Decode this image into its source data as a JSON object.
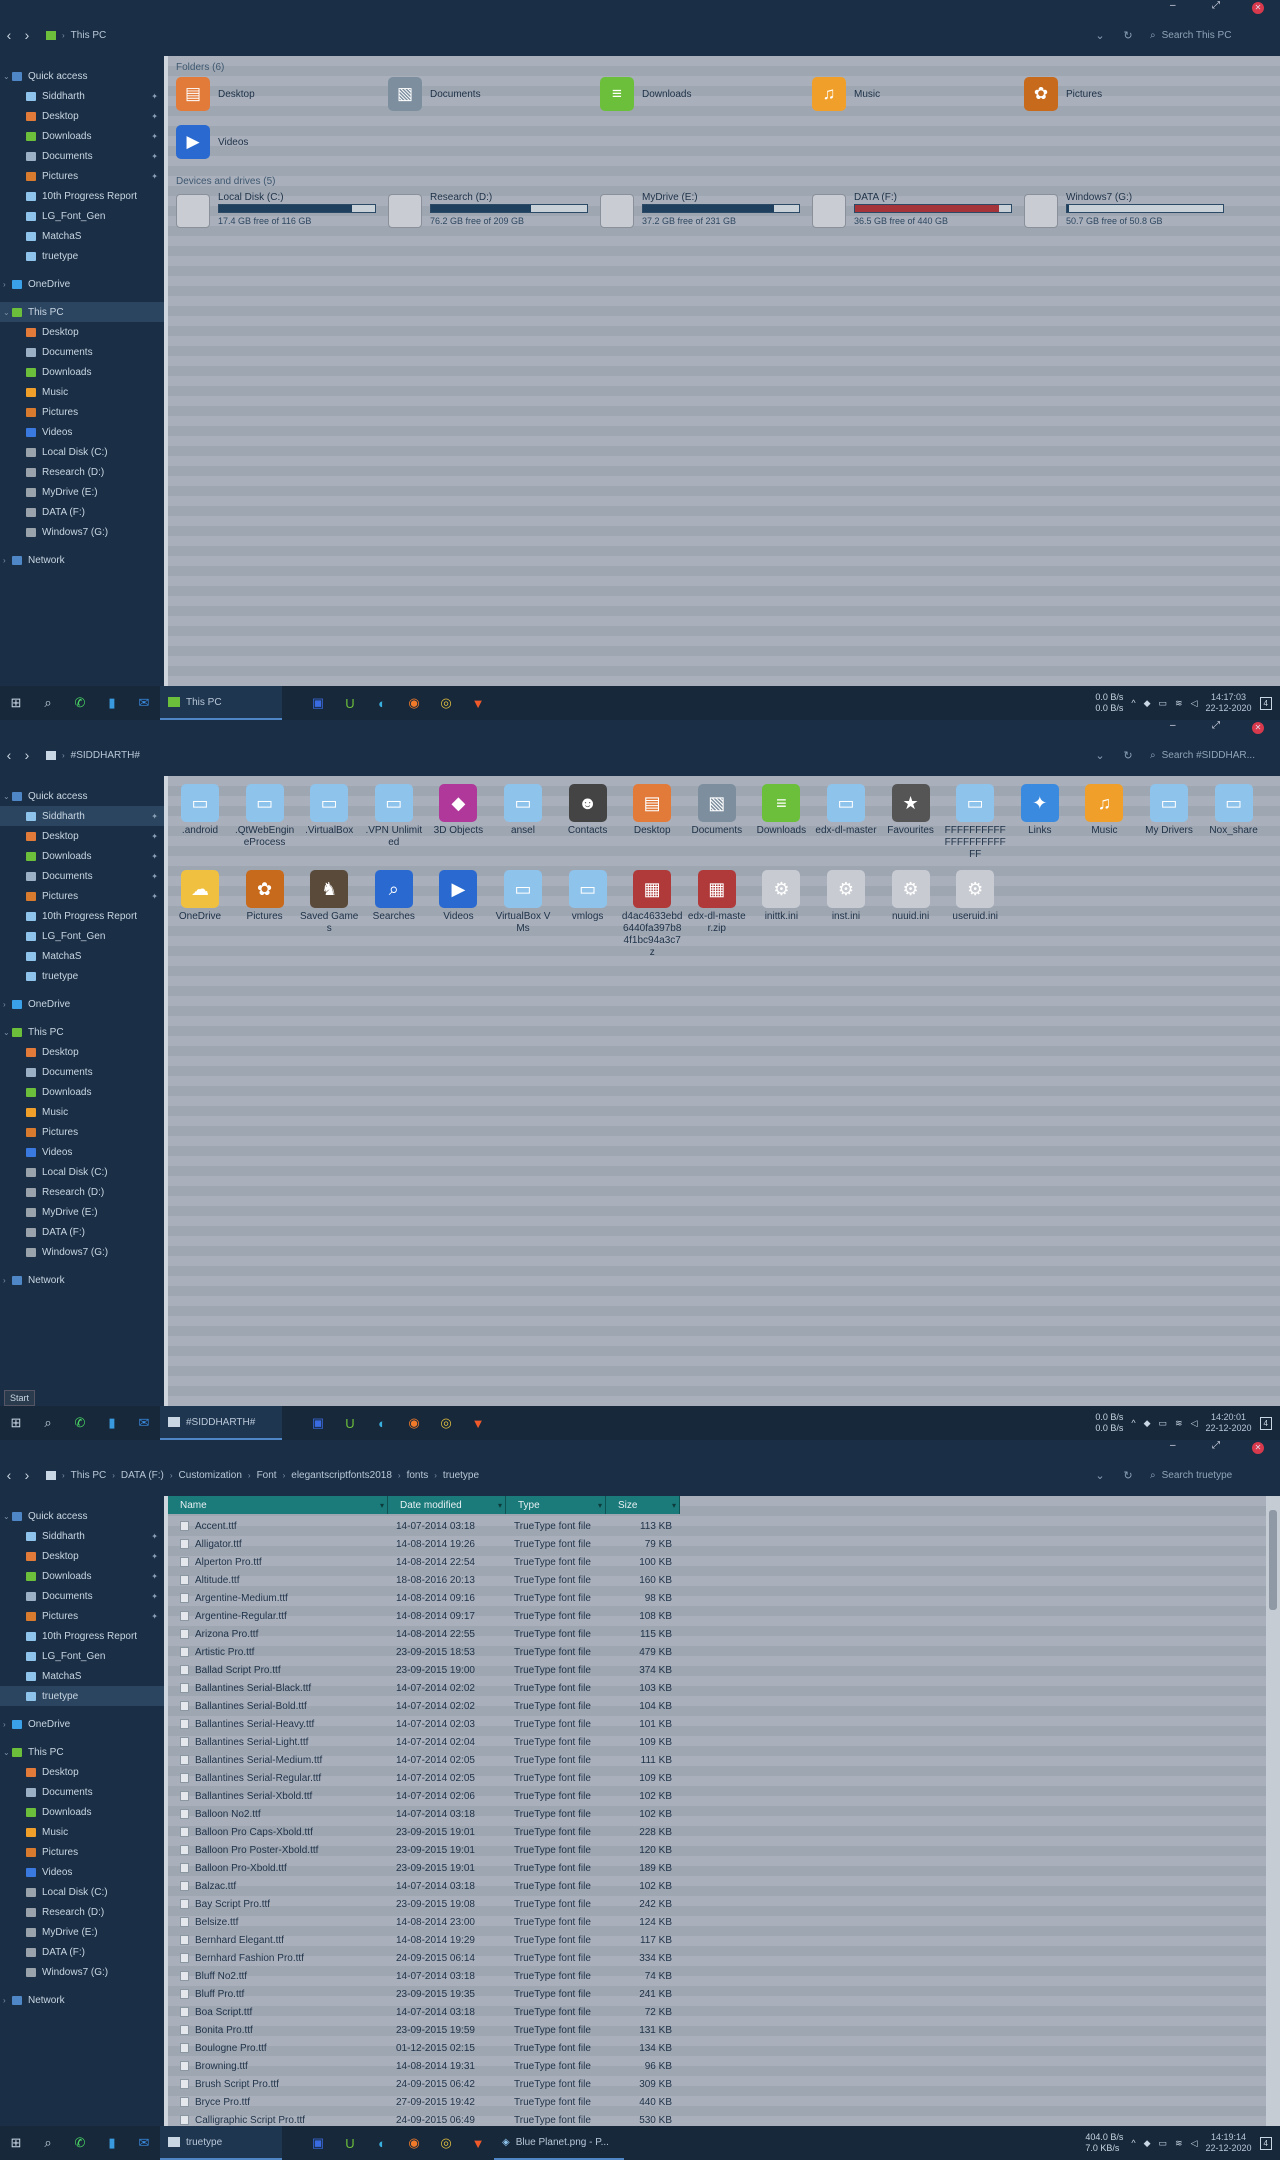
{
  "window_controls": {
    "minimize": "–",
    "maximize": "⤢",
    "close": "✕"
  },
  "nav": {
    "back": "‹",
    "forward": "›",
    "up": "↑",
    "refresh": "↻",
    "dropdown": "⌄"
  },
  "panel1": {
    "breadcrumbs": [
      "This PC"
    ],
    "search_placeholder": "Search This PC",
    "sidebar": [
      {
        "label": "Quick access",
        "kind": "top",
        "color": "#4f86c6",
        "icon": "star-icon"
      },
      {
        "label": "Siddharth",
        "kind": "sub",
        "pin": true,
        "color": "#8ec3ec"
      },
      {
        "label": "Desktop",
        "kind": "sub",
        "pin": true,
        "color": "#e27a3a"
      },
      {
        "label": "Downloads",
        "kind": "sub",
        "pin": true,
        "color": "#6cbf3a"
      },
      {
        "label": "Documents",
        "kind": "sub",
        "pin": true,
        "color": "#9bb0c4"
      },
      {
        "label": "Pictures",
        "kind": "sub",
        "pin": true,
        "color": "#d97b2e"
      },
      {
        "label": "10th Progress Report",
        "kind": "sub",
        "color": "#8ec3ec"
      },
      {
        "label": "LG_Font_Gen",
        "kind": "sub",
        "color": "#8ec3ec"
      },
      {
        "label": "MatchaS",
        "kind": "sub",
        "color": "#8ec3ec"
      },
      {
        "label": "truetype",
        "kind": "sub",
        "color": "#8ec3ec"
      },
      {
        "label": "",
        "kind": "gap"
      },
      {
        "label": "OneDrive",
        "kind": "top",
        "color": "#3aa0e8",
        "icon": "cloud-icon"
      },
      {
        "label": "",
        "kind": "gap"
      },
      {
        "label": "This PC",
        "kind": "top",
        "sel": true,
        "color": "#6cbf3a",
        "icon": "computer-icon"
      },
      {
        "label": "Desktop",
        "kind": "sub",
        "color": "#e27a3a"
      },
      {
        "label": "Documents",
        "kind": "sub",
        "color": "#9bb0c4"
      },
      {
        "label": "Downloads",
        "kind": "sub",
        "color": "#6cbf3a"
      },
      {
        "label": "Music",
        "kind": "sub",
        "color": "#f0a02a"
      },
      {
        "label": "Pictures",
        "kind": "sub",
        "color": "#d97b2e"
      },
      {
        "label": "Videos",
        "kind": "sub",
        "color": "#3a7ae0"
      },
      {
        "label": "Local Disk (C:)",
        "kind": "sub",
        "color": "#9aa2ab"
      },
      {
        "label": "Research (D:)",
        "kind": "sub",
        "color": "#9aa2ab"
      },
      {
        "label": "MyDrive (E:)",
        "kind": "sub",
        "color": "#9aa2ab"
      },
      {
        "label": "DATA (F:)",
        "kind": "sub",
        "color": "#9aa2ab"
      },
      {
        "label": "Windows7 (G:)",
        "kind": "sub",
        "color": "#9aa2ab"
      },
      {
        "label": "",
        "kind": "gap"
      },
      {
        "label": "Network",
        "kind": "top",
        "color": "#4f86c6",
        "icon": "network-icon"
      }
    ],
    "folders_header": "Folders (6)",
    "folders": [
      {
        "label": "Desktop",
        "color": "#e27a3a",
        "glyph": "▤"
      },
      {
        "label": "Documents",
        "color": "#7d8f9f",
        "glyph": "▧"
      },
      {
        "label": "Downloads",
        "color": "#6cbf3a",
        "glyph": "≡"
      },
      {
        "label": "Music",
        "color": "#f0a02a",
        "glyph": "♫"
      },
      {
        "label": "Pictures",
        "color": "#c86a1c",
        "glyph": "✿"
      },
      {
        "label": "Videos",
        "color": "#2a6ad0",
        "glyph": "▶"
      }
    ],
    "drives_header": "Devices and drives (5)",
    "drives": [
      {
        "name": "Local Disk (C:)",
        "free": "17.4 GB free of 116 GB",
        "used": 0.85,
        "color": "#1f3f5f"
      },
      {
        "name": "Research (D:)",
        "free": "76.2 GB free of 209 GB",
        "used": 0.64,
        "color": "#1f3f5f"
      },
      {
        "name": "MyDrive (E:)",
        "free": "37.2 GB free of 231 GB",
        "used": 0.84,
        "color": "#1f3f5f"
      },
      {
        "name": "DATA (F:)",
        "free": "36.5 GB free of 440 GB",
        "used": 0.92,
        "color": "#a4333a"
      },
      {
        "name": "Windows7 (G:)",
        "free": "50.7 GB free of 50.8 GB",
        "used": 0.01,
        "color": "#1f3f5f"
      }
    ],
    "taskbar_app": "This PC",
    "speed_up": "0.0 B/s",
    "speed_down": "0.0 B/s",
    "time": "14:17:03",
    "date": "22-12-2020",
    "notif": "4"
  },
  "panel2": {
    "breadcrumbs": [
      "#SIDDHARTH#"
    ],
    "search_placeholder": "Search #SIDDHAR...",
    "sidebar_selected": "Siddharth",
    "items": [
      {
        "label": ".android",
        "color": "#8ec3ec",
        "glyph": "▭"
      },
      {
        "label": ".QtWebEngineProcess",
        "color": "#8ec3ec",
        "glyph": "▭"
      },
      {
        "label": ".VirtualBox",
        "color": "#8ec3ec",
        "glyph": "▭"
      },
      {
        "label": ".VPN Unlimited",
        "color": "#8ec3ec",
        "glyph": "▭"
      },
      {
        "label": "3D Objects",
        "color": "#b0389a",
        "glyph": "◆"
      },
      {
        "label": "ansel",
        "color": "#8ec3ec",
        "glyph": "▭"
      },
      {
        "label": "Contacts",
        "color": "#444444",
        "glyph": "☻"
      },
      {
        "label": "Desktop",
        "color": "#e27a3a",
        "glyph": "▤"
      },
      {
        "label": "Documents",
        "color": "#7d8f9f",
        "glyph": "▧"
      },
      {
        "label": "Downloads",
        "color": "#6cbf3a",
        "glyph": "≡"
      },
      {
        "label": "edx-dl-master",
        "color": "#8ec3ec",
        "glyph": "▭"
      },
      {
        "label": "Favourites",
        "color": "#555555",
        "glyph": "★"
      },
      {
        "label": "FFFFFFFFFFFFFFFFFFFFFF",
        "color": "#8ec3ec",
        "glyph": "▭"
      },
      {
        "label": "Links",
        "color": "#3a8ae0",
        "glyph": "✦"
      },
      {
        "label": "Music",
        "color": "#f0a02a",
        "glyph": "♫"
      },
      {
        "label": "My Drivers",
        "color": "#8ec3ec",
        "glyph": "▭"
      },
      {
        "label": "Nox_share",
        "color": "#8ec3ec",
        "glyph": "▭"
      },
      {
        "label": "OneDrive",
        "color": "#f0c040",
        "glyph": "☁"
      },
      {
        "label": "Pictures",
        "color": "#c86a1c",
        "glyph": "✿"
      },
      {
        "label": "Saved Games",
        "color": "#5a4a3a",
        "glyph": "♞"
      },
      {
        "label": "Searches",
        "color": "#2a6ad0",
        "glyph": "⌕"
      },
      {
        "label": "Videos",
        "color": "#2a6ad0",
        "glyph": "▶"
      },
      {
        "label": "VirtualBox VMs",
        "color": "#8ec3ec",
        "glyph": "▭"
      },
      {
        "label": "vmlogs",
        "color": "#8ec3ec",
        "glyph": "▭"
      },
      {
        "label": "d4ac4633ebd6440fa397b84f1bc94a3c7z",
        "color": "#b03a3a",
        "glyph": "▦"
      },
      {
        "label": "edx-dl-master.zip",
        "color": "#b03a3a",
        "glyph": "▦"
      },
      {
        "label": "inittk.ini",
        "color": "#c8ccd2",
        "glyph": "⚙"
      },
      {
        "label": "inst.ini",
        "color": "#c8ccd2",
        "glyph": "⚙"
      },
      {
        "label": "nuuid.ini",
        "color": "#c8ccd2",
        "glyph": "⚙"
      },
      {
        "label": "useruid.ini",
        "color": "#c8ccd2",
        "glyph": "⚙"
      }
    ],
    "tooltip": "Start",
    "taskbar_app": "#SIDDHARTH#",
    "speed_up": "0.0 B/s",
    "speed_down": "0.0 B/s",
    "time": "14:20:01",
    "date": "22-12-2020",
    "notif": "4"
  },
  "panel3": {
    "breadcrumbs": [
      "This PC",
      "DATA (F:)",
      "Customization",
      "Font",
      "elegantscriptfonts2018",
      "fonts",
      "truetype"
    ],
    "search_placeholder": "Search truetype",
    "sidebar_selected": "truetype",
    "columns": [
      "Name",
      "Date modified",
      "Type",
      "Size"
    ],
    "rows": [
      [
        "Accent.ttf",
        "14-07-2014 03:18",
        "TrueType font file",
        "113 KB"
      ],
      [
        "Alligator.ttf",
        "14-08-2014 19:26",
        "TrueType font file",
        "79 KB"
      ],
      [
        "Alperton Pro.ttf",
        "14-08-2014 22:54",
        "TrueType font file",
        "100 KB"
      ],
      [
        "Altitude.ttf",
        "18-08-2016 20:13",
        "TrueType font file",
        "160 KB"
      ],
      [
        "Argentine-Medium.ttf",
        "14-08-2014 09:16",
        "TrueType font file",
        "98 KB"
      ],
      [
        "Argentine-Regular.ttf",
        "14-08-2014 09:17",
        "TrueType font file",
        "108 KB"
      ],
      [
        "Arizona Pro.ttf",
        "14-08-2014 22:55",
        "TrueType font file",
        "115 KB"
      ],
      [
        "Artistic Pro.ttf",
        "23-09-2015 18:53",
        "TrueType font file",
        "479 KB"
      ],
      [
        "Ballad Script Pro.ttf",
        "23-09-2015 19:00",
        "TrueType font file",
        "374 KB"
      ],
      [
        "Ballantines Serial-Black.ttf",
        "14-07-2014 02:02",
        "TrueType font file",
        "103 KB"
      ],
      [
        "Ballantines Serial-Bold.ttf",
        "14-07-2014 02:02",
        "TrueType font file",
        "104 KB"
      ],
      [
        "Ballantines Serial-Heavy.ttf",
        "14-07-2014 02:03",
        "TrueType font file",
        "101 KB"
      ],
      [
        "Ballantines Serial-Light.ttf",
        "14-07-2014 02:04",
        "TrueType font file",
        "109 KB"
      ],
      [
        "Ballantines Serial-Medium.ttf",
        "14-07-2014 02:05",
        "TrueType font file",
        "111 KB"
      ],
      [
        "Ballantines Serial-Regular.ttf",
        "14-07-2014 02:05",
        "TrueType font file",
        "109 KB"
      ],
      [
        "Ballantines Serial-Xbold.ttf",
        "14-07-2014 02:06",
        "TrueType font file",
        "102 KB"
      ],
      [
        "Balloon No2.ttf",
        "14-07-2014 03:18",
        "TrueType font file",
        "102 KB"
      ],
      [
        "Balloon Pro Caps-Xbold.ttf",
        "23-09-2015 19:01",
        "TrueType font file",
        "228 KB"
      ],
      [
        "Balloon Pro Poster-Xbold.ttf",
        "23-09-2015 19:01",
        "TrueType font file",
        "120 KB"
      ],
      [
        "Balloon Pro-Xbold.ttf",
        "23-09-2015 19:01",
        "TrueType font file",
        "189 KB"
      ],
      [
        "Balzac.ttf",
        "14-07-2014 03:18",
        "TrueType font file",
        "102 KB"
      ],
      [
        "Bay Script Pro.ttf",
        "23-09-2015 19:08",
        "TrueType font file",
        "242 KB"
      ],
      [
        "Belsize.ttf",
        "14-08-2014 23:00",
        "TrueType font file",
        "124 KB"
      ],
      [
        "Bernhard Elegant.ttf",
        "14-08-2014 19:29",
        "TrueType font file",
        "117 KB"
      ],
      [
        "Bernhard Fashion Pro.ttf",
        "24-09-2015 06:14",
        "TrueType font file",
        "334 KB"
      ],
      [
        "Bluff No2.ttf",
        "14-07-2014 03:18",
        "TrueType font file",
        "74 KB"
      ],
      [
        "Bluff Pro.ttf",
        "23-09-2015 19:35",
        "TrueType font file",
        "241 KB"
      ],
      [
        "Boa Script.ttf",
        "14-07-2014 03:18",
        "TrueType font file",
        "72 KB"
      ],
      [
        "Bonita Pro.ttf",
        "23-09-2015 19:59",
        "TrueType font file",
        "131 KB"
      ],
      [
        "Boulogne Pro.ttf",
        "01-12-2015 02:15",
        "TrueType font file",
        "134 KB"
      ],
      [
        "Browning.ttf",
        "14-08-2014 19:31",
        "TrueType font file",
        "96 KB"
      ],
      [
        "Brush Script Pro.ttf",
        "24-09-2015 06:42",
        "TrueType font file",
        "309 KB"
      ],
      [
        "Bryce Pro.ttf",
        "27-09-2015 19:42",
        "TrueType font file",
        "440 KB"
      ],
      [
        "Calligraphic Script Pro.ttf",
        "24-09-2015 06:49",
        "TrueType font file",
        "530 KB"
      ]
    ],
    "taskbar_app": "truetype",
    "taskbar_app2": "Blue Planet.png - P...",
    "speed_up": "404.0 B/s",
    "speed_down": "7.0 KB/s",
    "time": "14:19:14",
    "date": "22-12-2020",
    "notif": "4"
  },
  "taskbar_icons": [
    {
      "name": "windows-start-icon",
      "glyph": "⊞",
      "color": "#c9d6e3"
    },
    {
      "name": "search-icon",
      "glyph": "⌕",
      "color": "#c9d6e3"
    },
    {
      "name": "whatsapp-icon",
      "glyph": "✆",
      "color": "#4cd964"
    },
    {
      "name": "phone-icon",
      "glyph": "▮",
      "color": "#3a9ae0"
    },
    {
      "name": "mail-icon",
      "glyph": "✉",
      "color": "#3a8ae0"
    }
  ],
  "taskbar_icons_right": [
    {
      "name": "app-blue-icon",
      "glyph": "▣",
      "color": "#3a6ae0"
    },
    {
      "name": "upwork-icon",
      "glyph": "U",
      "color": "#6cbf3a"
    },
    {
      "name": "edge-icon",
      "glyph": "◐",
      "color": "#3ab0e0"
    },
    {
      "name": "firefox-icon",
      "glyph": "◉",
      "color": "#f07a2a"
    },
    {
      "name": "chrome-icon",
      "glyph": "◎",
      "color": "#e0c040"
    },
    {
      "name": "brave-icon",
      "glyph": "▼",
      "color": "#f05a2a"
    }
  ]
}
